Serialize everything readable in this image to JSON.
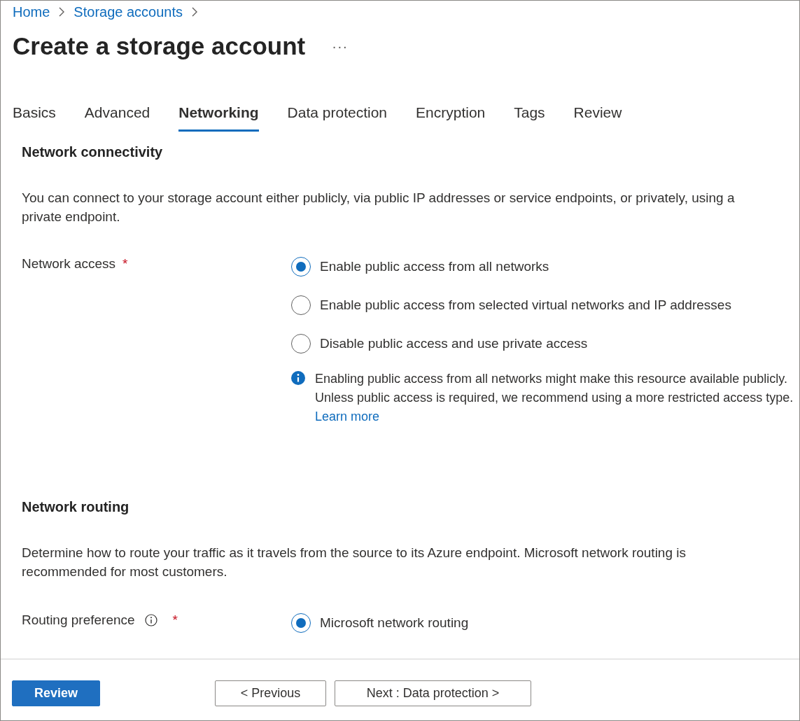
{
  "breadcrumb": [
    "Home",
    "Storage accounts"
  ],
  "title": "Create a storage account",
  "more": "···",
  "tabs": [
    {
      "label": "Basics",
      "selected": false
    },
    {
      "label": "Advanced",
      "selected": false
    },
    {
      "label": "Networking",
      "selected": true
    },
    {
      "label": "Data protection",
      "selected": false
    },
    {
      "label": "Encryption",
      "selected": false
    },
    {
      "label": "Tags",
      "selected": false
    },
    {
      "label": "Review",
      "selected": false
    }
  ],
  "sections": [
    {
      "heading": "Network connectivity",
      "description": "You can connect to your storage account either publicly, via public IP addresses or service endpoints, or privately, using a private endpoint.",
      "field": {
        "label": "Network access",
        "info": false,
        "required_mark": "*",
        "options": [
          {
            "label": "Enable public access from all networks",
            "selected": true
          },
          {
            "label": "Enable public access from selected virtual networks and IP addresses",
            "selected": false
          },
          {
            "label": "Disable public access and use private access",
            "selected": false
          }
        ],
        "note": {
          "text": "Enabling public access from all networks might make this resource available publicly. Unless public access is required, we recommend using a more restricted access type.",
          "link": "Learn more"
        }
      }
    },
    {
      "heading": "Network routing",
      "description": "Determine how to route your traffic as it travels from the source to its Azure endpoint. Microsoft network routing is recommended for most customers.",
      "field": {
        "label": "Routing preference",
        "info": true,
        "required_mark": "*",
        "options": [
          {
            "label": "Microsoft network routing",
            "selected": true
          }
        ]
      }
    }
  ],
  "footer": [
    {
      "label": "Review",
      "kind": "primary"
    },
    {
      "label": "< Previous",
      "kind": "secondary"
    },
    {
      "label": "Next : Data protection >",
      "kind": "secondary"
    }
  ]
}
